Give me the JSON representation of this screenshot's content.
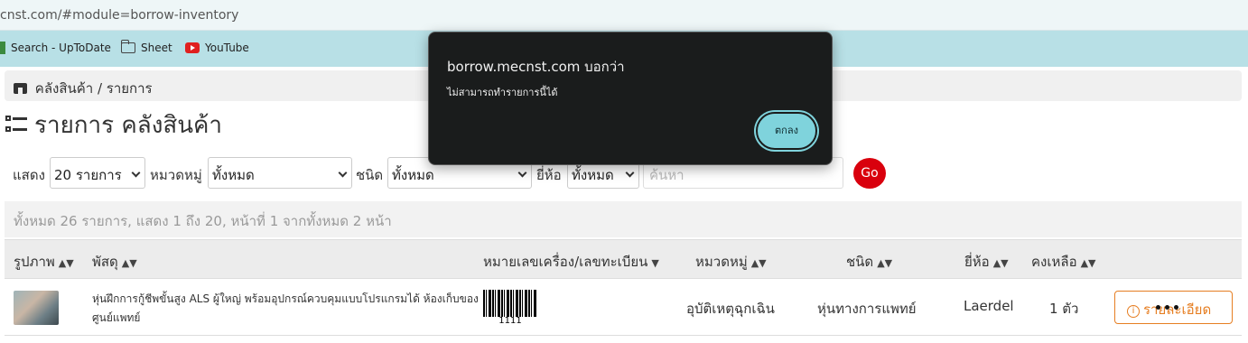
{
  "browser": {
    "url": "cnst.com/#module=borrow-inventory",
    "bookmarks": [
      "Search - UpToDate",
      "Sheet",
      "YouTube"
    ]
  },
  "breadcrumb": "คลังสินค้า / รายการ",
  "page_title": "รายการ คลังสินค้า",
  "filters": {
    "show_label": "แสดง",
    "show_value": "20 รายการ",
    "category_label": "หมวดหมู่",
    "category_value": "ทั้งหมด",
    "type_label": "ชนิด",
    "type_value": "ทั้งหมด",
    "brand_label": "ยี่ห้อ",
    "brand_value": "ทั้งหมด",
    "search_placeholder": "ค้นหา",
    "go_label": "Go"
  },
  "summary": "ทั้งหมด 26 รายการ, แสดง 1 ถึง 20, หน้าที่ 1 จากทั้งหมด 2 หน้า",
  "table": {
    "columns": [
      "รูปภาพ",
      "พัสดุ",
      "หมายเลขเครื่อง/เลขทะเบียน",
      "หมวดหมู่",
      "ชนิด",
      "ยี่ห้อ",
      "คงเหลือ"
    ],
    "rows": [
      {
        "item": "หุ่นฝึกการกู้ชีพขั้นสูง ALS ผู้ใหญ่ พร้อมอุปกรณ์ควบคุมแบบโปรแกรมได้ ห้องเก็บของศูนย์แพทย์",
        "barcode_number": "1111",
        "category": "อุบัติเหตุฉุกเฉิน",
        "type": "หุ่นทางการแพทย์",
        "brand": "Laerdel",
        "remaining": "1 ตัว",
        "detail_label": "รายละเอียด"
      }
    ]
  },
  "dialog": {
    "title": "borrow.mecnst.com บอกว่า",
    "message": "ไม่สามารถทำรายการนี้ได้",
    "ok_label": "ตกลง"
  },
  "colors": {
    "bookmark_bar": "#b8e0e6",
    "go_button": "#d9000d",
    "detail_button": "#e67e22",
    "dialog_bg": "#1a1c1c",
    "dialog_button": "#7fd3dc"
  }
}
